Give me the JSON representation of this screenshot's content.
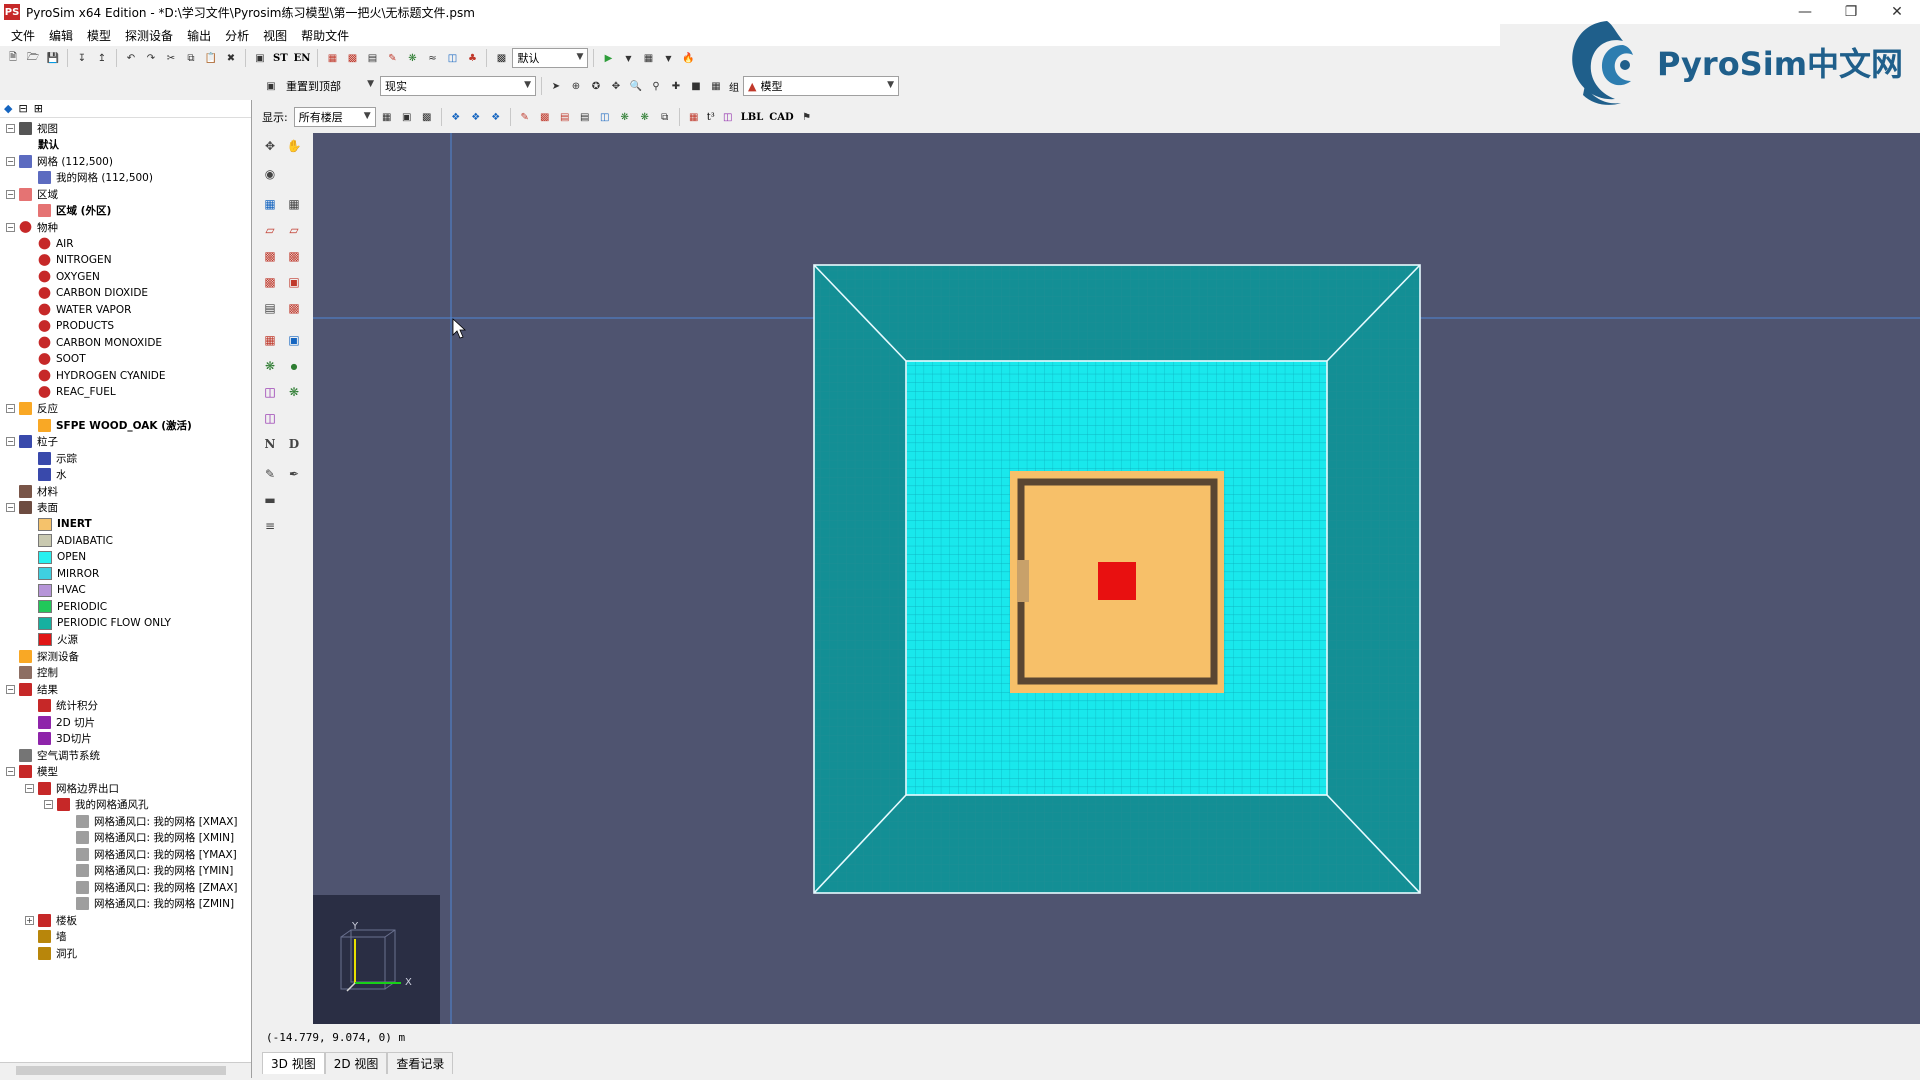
{
  "window": {
    "title": "PyroSim x64 Edition - *D:\\学习文件\\Pyrosim练习模型\\第一把火\\无标题文件.psm",
    "icon_label": "PS"
  },
  "menu": [
    "文件",
    "编辑",
    "模型",
    "探测设备",
    "输出",
    "分析",
    "视图",
    "帮助文件"
  ],
  "logo": {
    "text": "PyroSim中文网"
  },
  "toolbar1": {
    "st_label": "ST",
    "en_label": "EN",
    "view_combo": "默认"
  },
  "toolbar2": {
    "reset_label": "重置到顶部",
    "render_combo": "现实",
    "group_label": "组",
    "model_combo": "模型"
  },
  "toolbar3": {
    "show_label": "显示:",
    "floor_combo": "所有楼层",
    "lbl_label": "LBL",
    "cad_label": "CAD",
    "t3_label": "t³"
  },
  "tree": [
    {
      "label": "视图",
      "level": 0,
      "exp": "−",
      "icon": "view"
    },
    {
      "label": "默认",
      "level": 1,
      "bold": true
    },
    {
      "label": "网格 (112,500)",
      "level": 0,
      "exp": "−",
      "icon": "mesh"
    },
    {
      "label": "我的网格 (112,500)",
      "level": 1,
      "icon": "mesh"
    },
    {
      "label": "区域",
      "level": 0,
      "exp": "−",
      "icon": "zone"
    },
    {
      "label": "区域 (外区)",
      "level": 1,
      "bold": true,
      "icon": "zone"
    },
    {
      "label": "物种",
      "level": 0,
      "exp": "−",
      "icon": "species"
    },
    {
      "label": "AIR",
      "level": 1,
      "icon": "species"
    },
    {
      "label": "NITROGEN",
      "level": 1,
      "icon": "species"
    },
    {
      "label": "OXYGEN",
      "level": 1,
      "icon": "species"
    },
    {
      "label": "CARBON DIOXIDE",
      "level": 1,
      "icon": "species"
    },
    {
      "label": "WATER VAPOR",
      "level": 1,
      "icon": "species"
    },
    {
      "label": "PRODUCTS",
      "level": 1,
      "icon": "species"
    },
    {
      "label": "CARBON MONOXIDE",
      "level": 1,
      "icon": "species"
    },
    {
      "label": "SOOT",
      "level": 1,
      "icon": "species"
    },
    {
      "label": "HYDROGEN CYANIDE",
      "level": 1,
      "icon": "species"
    },
    {
      "label": "REAC_FUEL",
      "level": 1,
      "icon": "species"
    },
    {
      "label": "反应",
      "level": 0,
      "exp": "−",
      "icon": "reaction"
    },
    {
      "label": "SFPE WOOD_OAK (激活)",
      "level": 1,
      "bold": true,
      "icon": "reaction"
    },
    {
      "label": "粒子",
      "level": 0,
      "exp": "−",
      "icon": "particle"
    },
    {
      "label": "示踪",
      "level": 1,
      "icon": "particle"
    },
    {
      "label": "水",
      "level": 1,
      "icon": "particle"
    },
    {
      "label": "材料",
      "level": 0,
      "icon": "material"
    },
    {
      "label": "表面",
      "level": 0,
      "exp": "−",
      "icon": "surface"
    },
    {
      "label": "INERT",
      "level": 1,
      "bold": true,
      "swatch": "#f5c26b"
    },
    {
      "label": "ADIABATIC",
      "level": 1,
      "swatch": "#c9c9b0"
    },
    {
      "label": "OPEN",
      "level": 1,
      "swatch": "#28f0f0"
    },
    {
      "label": "MIRROR",
      "level": 1,
      "swatch": "#3fd0e0"
    },
    {
      "label": "HVAC",
      "level": 1,
      "swatch": "#b695d8"
    },
    {
      "label": "PERIODIC",
      "level": 1,
      "swatch": "#21c85a"
    },
    {
      "label": "PERIODIC FLOW ONLY",
      "level": 1,
      "swatch": "#16b0a0"
    },
    {
      "label": "火源",
      "level": 1,
      "swatch": "#e01515"
    },
    {
      "label": "探测设备",
      "level": 0,
      "icon": "device"
    },
    {
      "label": "控制",
      "level": 0,
      "icon": "control"
    },
    {
      "label": "结果",
      "level": 0,
      "exp": "−",
      "icon": "result"
    },
    {
      "label": "统计积分",
      "level": 1,
      "icon": "result"
    },
    {
      "label": "2D 切片",
      "level": 1,
      "icon": "slice"
    },
    {
      "label": "3D切片",
      "level": 1,
      "icon": "slice"
    },
    {
      "label": "空气调节系统",
      "level": 0,
      "icon": "hvac"
    },
    {
      "label": "模型",
      "level": 0,
      "exp": "−",
      "icon": "model"
    },
    {
      "label": "网格边界出口",
      "level": 1,
      "exp": "−",
      "icon": "model"
    },
    {
      "label": "我的网格通风孔",
      "level": 2,
      "exp": "−",
      "icon": "model"
    },
    {
      "label": "网格通风口: 我的网格 [XMAX]",
      "level": 3,
      "icon": "vent"
    },
    {
      "label": "网格通风口: 我的网格 [XMIN]",
      "level": 3,
      "icon": "vent"
    },
    {
      "label": "网格通风口: 我的网格 [YMAX]",
      "level": 3,
      "icon": "vent"
    },
    {
      "label": "网格通风口: 我的网格 [YMIN]",
      "level": 3,
      "icon": "vent"
    },
    {
      "label": "网格通风口: 我的网格 [ZMAX]",
      "level": 3,
      "icon": "vent"
    },
    {
      "label": "网格通风口: 我的网格 [ZMIN]",
      "level": 3,
      "icon": "vent"
    },
    {
      "label": "楼板",
      "level": 1,
      "exp": "+",
      "icon": "model"
    },
    {
      "label": "墙",
      "level": 1,
      "icon": "wall"
    },
    {
      "label": "洞孔",
      "level": 1,
      "icon": "wall"
    }
  ],
  "axes": {
    "y": "Y",
    "x": "X"
  },
  "status": {
    "coords": "(-14.779, 9.074, 0) m"
  },
  "tabs": [
    "3D 视图",
    "2D 视图",
    "查看记录"
  ],
  "colors": {
    "viewport_bg": "#4f5470",
    "mesh_cyan": "#19e8ec",
    "mesh_dark": "#13a7a8",
    "obstruction": "#f7c069",
    "wall_dark": "#5a4632",
    "fire": "#e81010"
  }
}
